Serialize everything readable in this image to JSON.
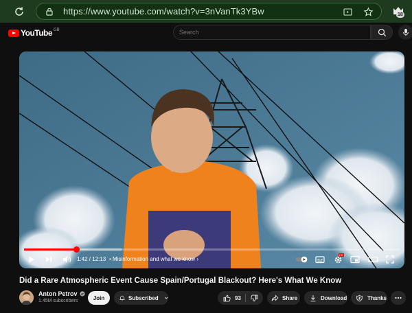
{
  "browser": {
    "url": "https://www.youtube.com/watch?v=3nVanTk3YBw",
    "profile_badge": "18"
  },
  "youtube": {
    "logo_text": "YouTube",
    "region": "GB",
    "search_placeholder": "Search"
  },
  "player": {
    "current_time": "1:42",
    "duration": "12:13",
    "time_display": "1:42 / 12:13",
    "chapter": "Misinformation and what we know",
    "progress_fraction": 0.139,
    "buffered_fraction": 0.26,
    "quality_badge": "HD",
    "accent": "#ff0000"
  },
  "video": {
    "title": "Did a Rare Atmospheric Event Cause Spain/Portugal Blackout? Here's What We Know"
  },
  "channel": {
    "name": "Anton Petrov",
    "subscribers": "1.45M subscribers",
    "verified_icon": "check-circle-icon"
  },
  "actions": {
    "join": "Join",
    "subscribed": "Subscribed",
    "likes": "93",
    "share": "Share",
    "download": "Download",
    "thanks": "Thanks"
  }
}
